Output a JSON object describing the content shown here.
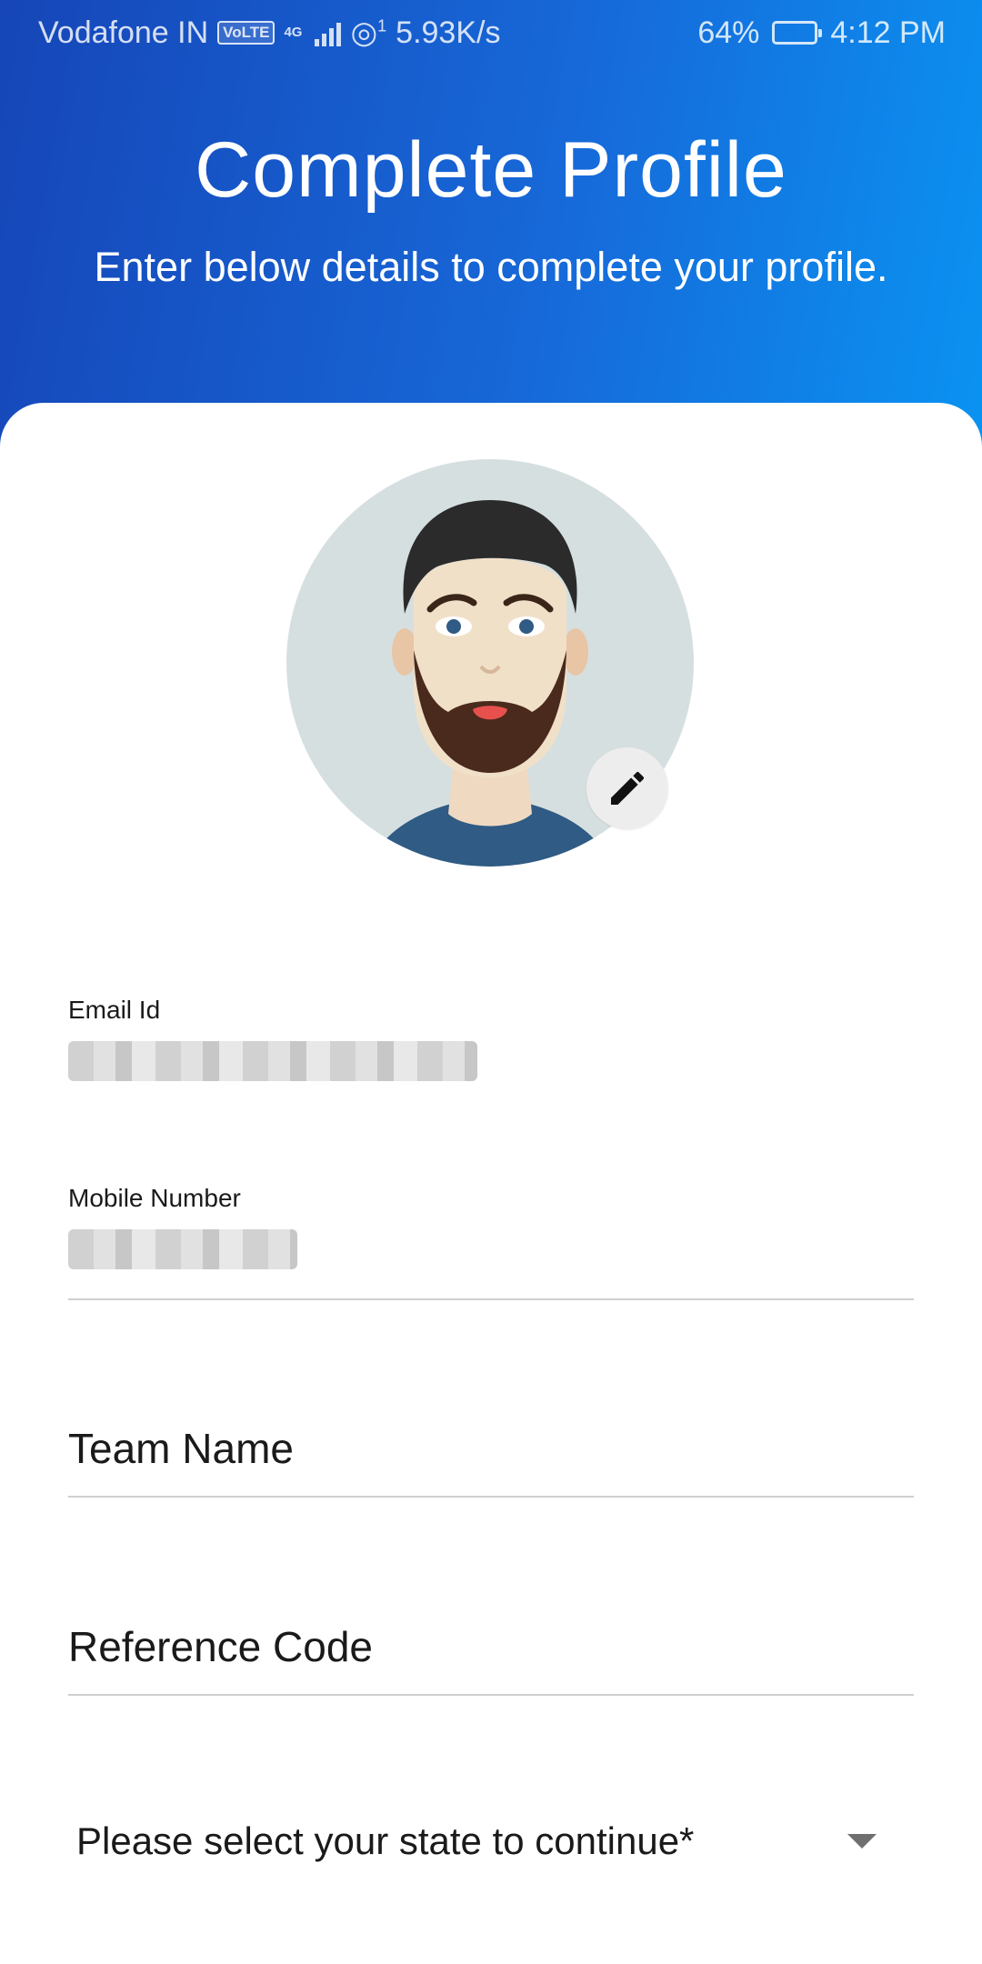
{
  "status_bar": {
    "carrier": "Vodafone IN",
    "volte": "VoLTE",
    "network": "4G",
    "hotspot_count": "1",
    "speed": "5.93K/s",
    "battery": "64%",
    "battery_level": 0.64,
    "time": "4:12 PM"
  },
  "header": {
    "title": "Complete Profile",
    "subtitle": "Enter below details to complete your profile."
  },
  "avatar": {
    "icon": "user-avatar-illustration",
    "edit_icon": "pencil-icon"
  },
  "form": {
    "email": {
      "label": "Email Id"
    },
    "mobile": {
      "label": "Mobile Number"
    },
    "team_name": {
      "placeholder": "Team Name"
    },
    "reference_code": {
      "placeholder": "Reference Code"
    },
    "state": {
      "placeholder": "Please select your state to continue*"
    }
  },
  "colors": {
    "header_start": "#1646b8",
    "header_end": "#0a93f2",
    "card": "#ffffff",
    "underline": "#cfcfcf"
  }
}
